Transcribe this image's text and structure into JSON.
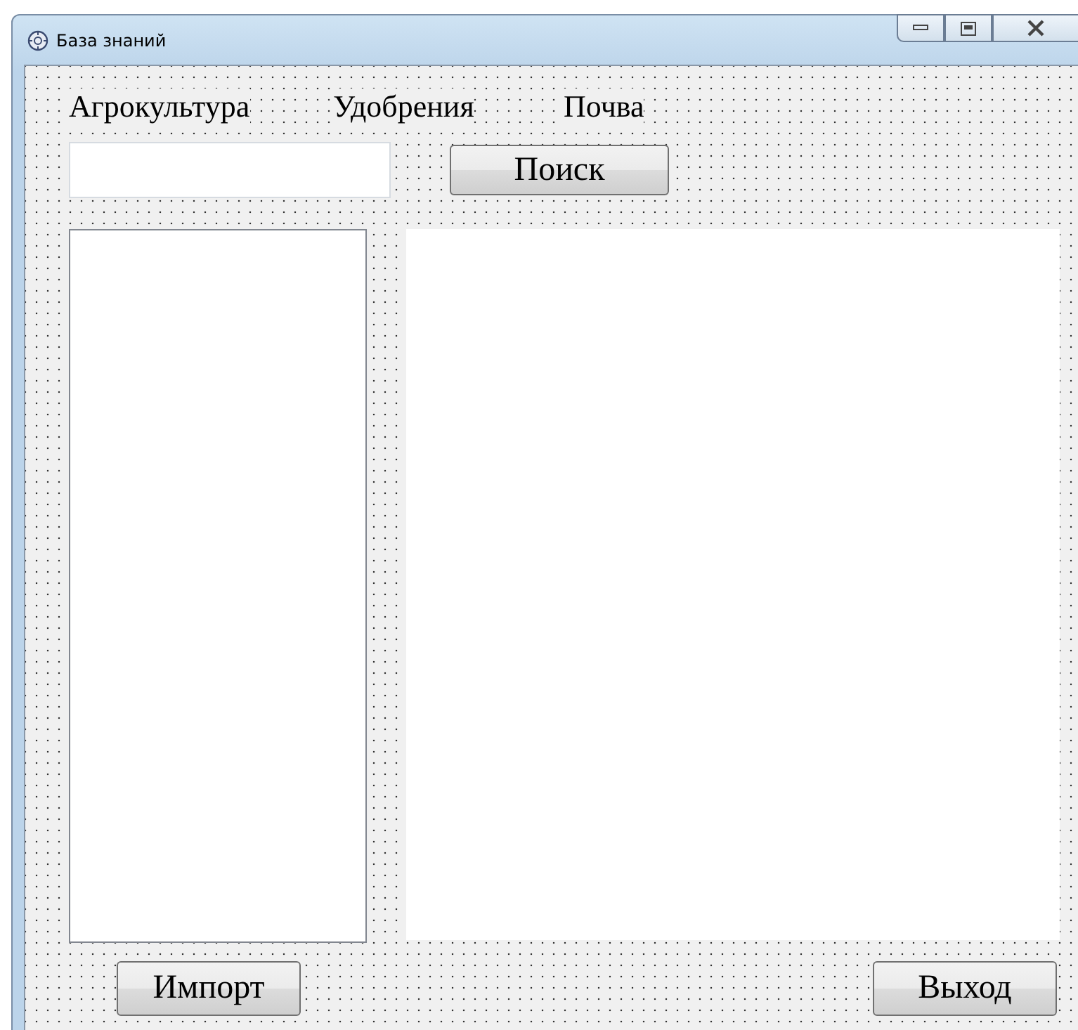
{
  "window": {
    "title": "База знаний"
  },
  "labels": [
    "Агрокультура",
    "Удобрения",
    "Почва"
  ],
  "search_button": "Поиск",
  "bottom_buttons": [
    "Импорт",
    "Выход"
  ]
}
